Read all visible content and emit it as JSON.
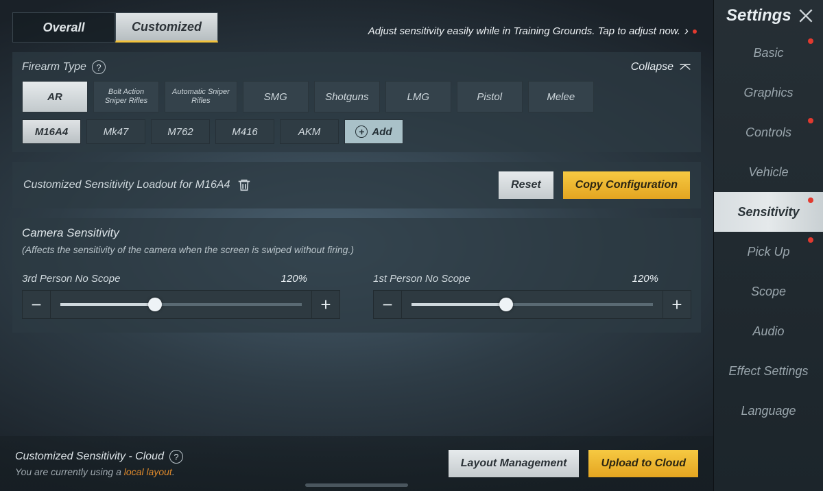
{
  "sidebar": {
    "title": "Settings",
    "items": [
      {
        "label": "Basic",
        "dot": true,
        "selected": false
      },
      {
        "label": "Graphics",
        "dot": false,
        "selected": false
      },
      {
        "label": "Controls",
        "dot": true,
        "selected": false
      },
      {
        "label": "Vehicle",
        "dot": false,
        "selected": false
      },
      {
        "label": "Sensitivity",
        "dot": true,
        "selected": true
      },
      {
        "label": "Pick Up",
        "dot": true,
        "selected": false
      },
      {
        "label": "Scope",
        "dot": false,
        "selected": false
      },
      {
        "label": "Audio",
        "dot": false,
        "selected": false
      },
      {
        "label": "Effect Settings",
        "dot": false,
        "selected": false
      },
      {
        "label": "Language",
        "dot": false,
        "selected": false
      }
    ]
  },
  "tabs": {
    "overall": "Overall",
    "customized": "Customized"
  },
  "tip": "Adjust sensitivity easily while in Training Grounds. Tap to adjust now.",
  "firearm": {
    "heading": "Firearm Type",
    "collapse": "Collapse",
    "types": [
      "AR",
      "Bolt Action Sniper Rifles",
      "Automatic Sniper Rifles",
      "SMG",
      "Shotguns",
      "LMG",
      "Pistol",
      "Melee"
    ],
    "weapons": [
      "M16A4",
      "Mk47",
      "M762",
      "M416",
      "AKM"
    ],
    "add": "Add"
  },
  "loadout": {
    "text": "Customized Sensitivity Loadout for M16A4",
    "reset": "Reset",
    "copy": "Copy Configuration"
  },
  "camera": {
    "title": "Camera Sensitivity",
    "sub": "(Affects the sensitivity of the camera when the screen is swiped without firing.)",
    "s1_name": "3rd Person No Scope",
    "s1_val": "120%",
    "s1_pct": 40,
    "s2_name": "1st Person No Scope",
    "s2_val": "120%",
    "s2_pct": 40
  },
  "cloud": {
    "title": "Customized Sensitivity - Cloud",
    "sub_a": "You are currently using a ",
    "sub_link": "local layout",
    "sub_b": ".",
    "layout": "Layout Management",
    "upload": "Upload to Cloud"
  }
}
